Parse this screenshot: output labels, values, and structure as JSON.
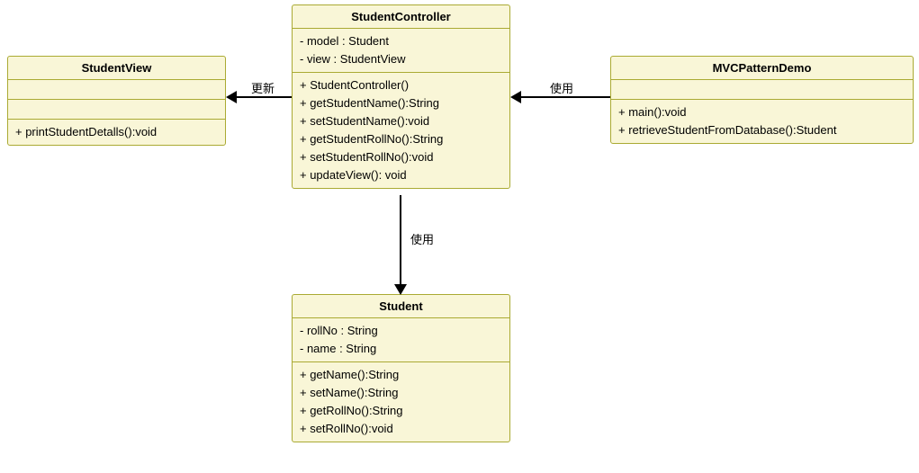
{
  "classes": {
    "studentView": {
      "name": "StudentView",
      "methods": [
        "+ printStudentDetalls():void"
      ]
    },
    "studentController": {
      "name": "StudentController",
      "attributes": [
        "- model : Student",
        "- view : StudentView"
      ],
      "methods": [
        "+ StudentController()",
        "+ getStudentName():String",
        "+ setStudentName():void",
        "+ getStudentRollNo():String",
        "+ setStudentRollNo():void",
        "+ updateView(): void"
      ]
    },
    "mvcPatternDemo": {
      "name": "MVCPatternDemo",
      "methods": [
        "+ main():void",
        "+ retrieveStudentFromDatabase():Student"
      ]
    },
    "student": {
      "name": "Student",
      "attributes": [
        "- rollNo : String",
        "- name : String"
      ],
      "methods": [
        "+ getName():String",
        "+ setName():String",
        "+ getRollNo():String",
        "+ setRollNo():void"
      ]
    }
  },
  "relations": {
    "controllerToView": "更新",
    "demoToController": "使用",
    "controllerToStudent": "使用"
  }
}
